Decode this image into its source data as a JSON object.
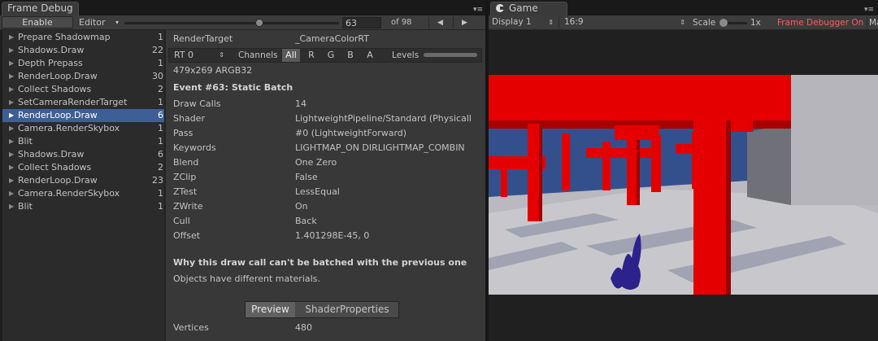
{
  "frame_debug": {
    "tab_title": "Frame Debug",
    "enable_label": "Enable",
    "editor_label": "Editor",
    "frame_index": "63",
    "frame_total": "of 98",
    "prev_label": "◀",
    "next_label": "▶",
    "events": [
      {
        "name": "Prepare Shadowmap",
        "count": "1"
      },
      {
        "name": "Shadows.Draw",
        "count": "22"
      },
      {
        "name": "Depth Prepass",
        "count": "1"
      },
      {
        "name": "RenderLoop.Draw",
        "count": "30"
      },
      {
        "name": "Collect Shadows",
        "count": "2"
      },
      {
        "name": "SetCameraRenderTarget",
        "count": "1"
      },
      {
        "name": "RenderLoop.Draw",
        "count": "6"
      },
      {
        "name": "Camera.RenderSkybox",
        "count": "1"
      },
      {
        "name": "Blit",
        "count": "1"
      },
      {
        "name": "Shadows.Draw",
        "count": "6"
      },
      {
        "name": "Collect Shadows",
        "count": "2"
      },
      {
        "name": "RenderLoop.Draw",
        "count": "23"
      },
      {
        "name": "Camera.RenderSkybox",
        "count": "1"
      },
      {
        "name": "Blit",
        "count": "1"
      }
    ],
    "selected_event_index": 6,
    "render_target_label": "RenderTarget",
    "render_target_value": "_CameraColorRT",
    "rt_select": "RT 0",
    "channels_label": "Channels",
    "channel_buttons": [
      "All",
      "R",
      "G",
      "B",
      "A"
    ],
    "levels_label": "Levels",
    "format": "479x269 ARGB32",
    "event_title": "Event #63: Static Batch",
    "properties": [
      {
        "key": "Draw Calls",
        "value": "14"
      },
      {
        "key": "Shader",
        "value": "LightweightPipeline/Standard (Physicall"
      },
      {
        "key": "Pass",
        "value": "#0 (LightweightForward)"
      },
      {
        "key": "Keywords",
        "value": "LIGHTMAP_ON DIRLIGHTMAP_COMBIN"
      },
      {
        "key": "Blend",
        "value": "One Zero"
      },
      {
        "key": "ZClip",
        "value": "False"
      },
      {
        "key": "ZTest",
        "value": "LessEqual"
      },
      {
        "key": "ZWrite",
        "value": "On"
      },
      {
        "key": "Cull",
        "value": "Back"
      },
      {
        "key": "Offset",
        "value": "1.401298E-45, 0"
      }
    ],
    "batch_question": "Why this draw call can't be batched with the previous one",
    "batch_answer": "Objects have different materials.",
    "tab_preview": "Preview",
    "tab_shader_props": "ShaderProperties",
    "vertices_label": "Vertices",
    "vertices_value": "480"
  },
  "game": {
    "tab_title": "Game",
    "display": "Display 1",
    "aspect": "16:9",
    "scale_label": "Scale",
    "scale_value": "1x",
    "frame_debugger_on": "Frame Debugger On",
    "maximize_cut": "Ma"
  },
  "colors": {
    "selection": "#3e5f96",
    "accent_red": "#ff5a5a",
    "scene_red": "#e40000",
    "sky": "#34508c"
  }
}
